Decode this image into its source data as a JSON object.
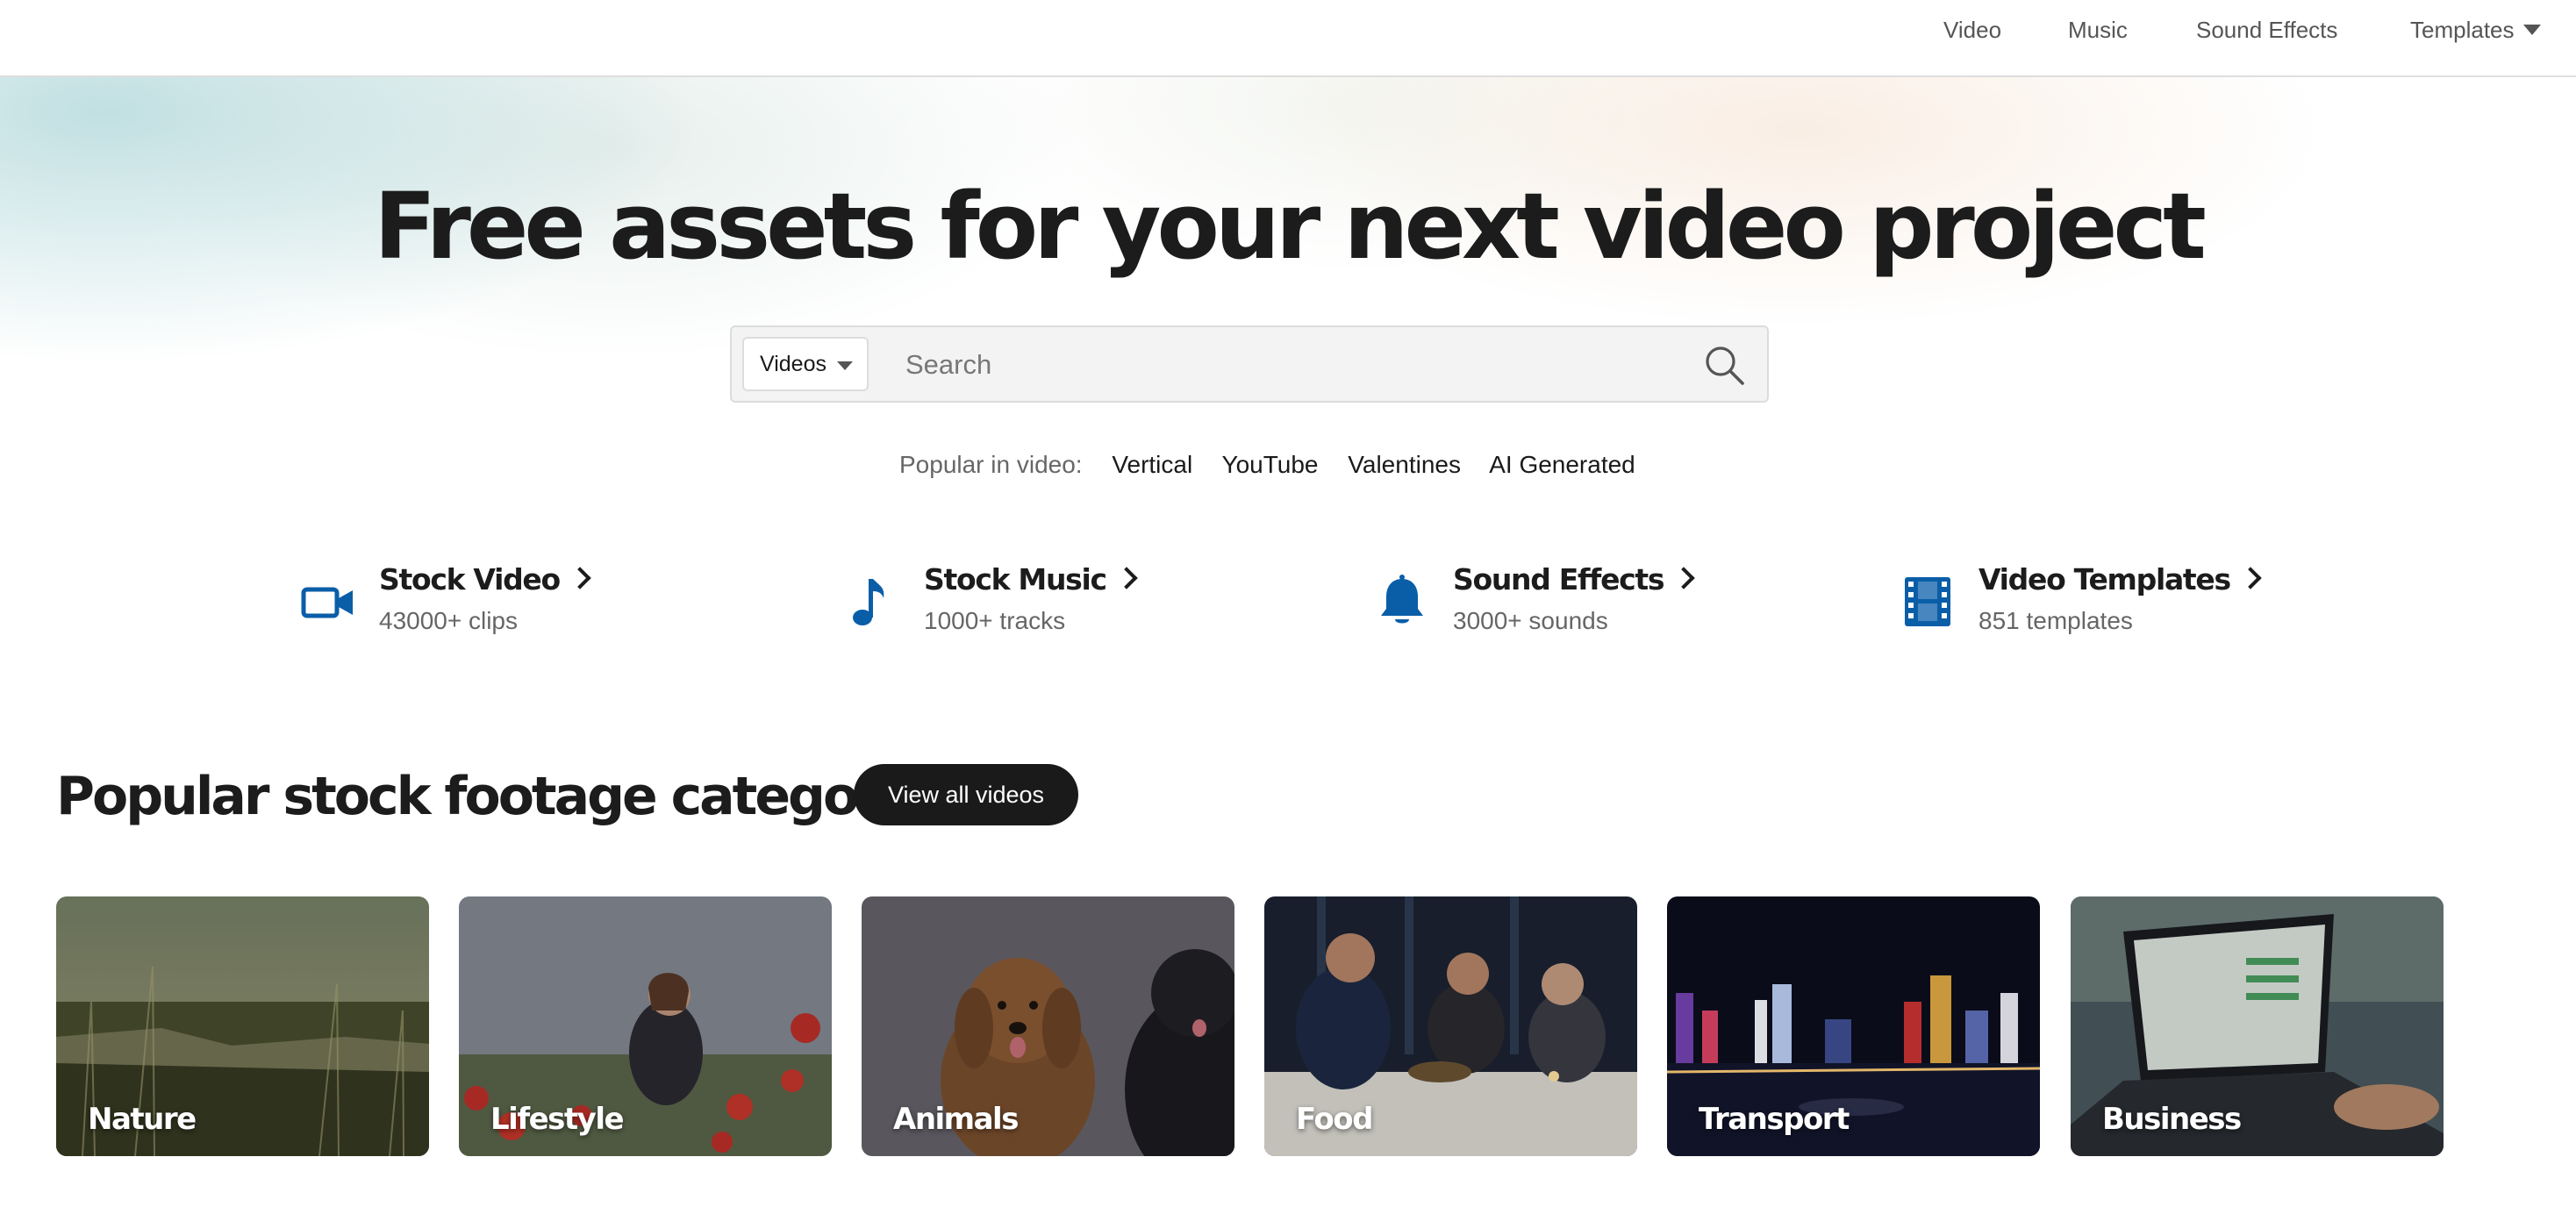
{
  "nav": {
    "items": [
      "Video",
      "Music",
      "Sound Effects"
    ],
    "templates_label": "Templates"
  },
  "hero": {
    "title": "Free assets for your next video project",
    "search": {
      "type_selected": "Videos",
      "placeholder": "Search",
      "value": ""
    },
    "popular": {
      "label": "Popular in video:",
      "links": [
        "Vertical",
        "YouTube",
        "Valentines",
        "AI Generated"
      ]
    }
  },
  "categories": [
    {
      "title": "Stock Video",
      "count": "43000+ clips",
      "icon": "video-camera-icon"
    },
    {
      "title": "Stock Music",
      "count": "1000+ tracks",
      "icon": "music-note-icon"
    },
    {
      "title": "Sound Effects",
      "count": "3000+ sounds",
      "icon": "bell-icon"
    },
    {
      "title": "Video Templates",
      "count": "851 templates",
      "icon": "film-strip-icon"
    }
  ],
  "footage": {
    "title": "Popular stock footage categories",
    "view_all": "View all videos",
    "tiles": [
      "Nature",
      "Lifestyle",
      "Animals",
      "Food",
      "Transport",
      "Business"
    ]
  },
  "colors": {
    "accent_blue": "#0a5ea8",
    "dark_button": "#1a1a1a",
    "nav_text": "#555555",
    "muted_text": "#666666"
  }
}
